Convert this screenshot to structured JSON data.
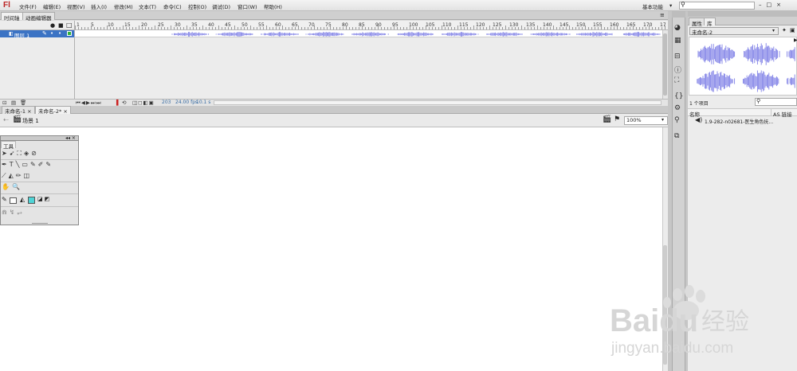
{
  "app": {
    "logo": "Fl"
  },
  "menu": [
    "文件(F)",
    "编辑(E)",
    "视图(V)",
    "插入(I)",
    "修改(M)",
    "文本(T)",
    "命令(C)",
    "控制(O)",
    "调试(D)",
    "窗口(W)",
    "帮助(H)"
  ],
  "header": {
    "workspace": "基本功能",
    "search_placeholder": ""
  },
  "timeline": {
    "tabs": [
      "时间轴",
      "动画编辑器"
    ],
    "ruler": [
      "1",
      "5",
      "10",
      "15",
      "20",
      "25",
      "30",
      "35",
      "40",
      "45",
      "50",
      "55",
      "60",
      "65",
      "70",
      "75",
      "80",
      "85",
      "90",
      "95",
      "100",
      "105",
      "110",
      "115",
      "120",
      "125",
      "130",
      "135",
      "140",
      "145",
      "150",
      "155",
      "160",
      "165",
      "170",
      "17"
    ],
    "layer": {
      "name": "图层 1",
      "num": "1"
    },
    "status": {
      "frame": "203",
      "fps": "24.00 fps",
      "time": "10.1 s"
    }
  },
  "documents": {
    "tabs": [
      "未命名-1",
      "未命名-2*"
    ]
  },
  "editbar": {
    "scene": "场景 1",
    "zoom": "100%"
  },
  "tools": {
    "title": "工具"
  },
  "library": {
    "tabs": [
      "属性",
      "库"
    ],
    "document": "未命名-2",
    "count": "1 个项目",
    "columns": {
      "name": "名称",
      "linkage": "AS 链接"
    },
    "items": [
      {
        "name": "1.9-282-n02681-医生角色抚..."
      }
    ]
  },
  "watermark": {
    "brand": "Baidu",
    "cn": "经验",
    "url": "jingyan.baidu.com"
  },
  "colors": {
    "layer_selected": "#3b73c4",
    "waveform": "#7f80e6",
    "fill": "#4fd4d6"
  }
}
